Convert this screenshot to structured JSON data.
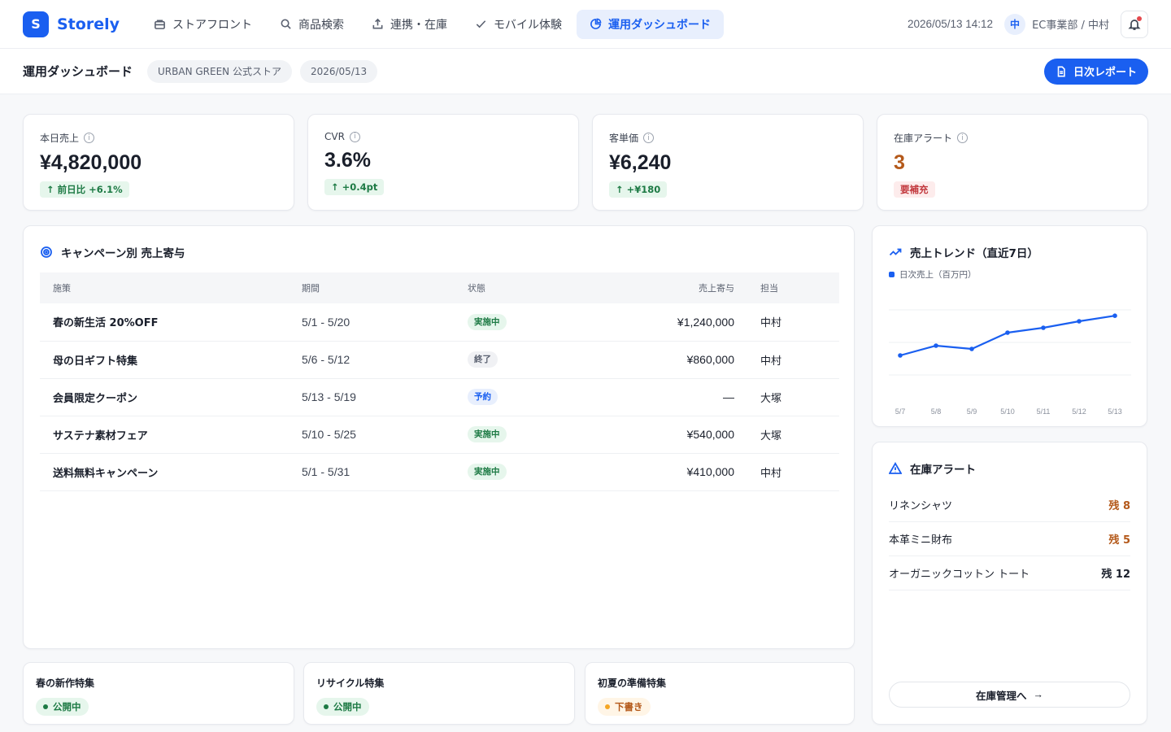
{
  "app": {
    "logo_letter": "S",
    "name": "Storely"
  },
  "nav": [
    {
      "label": "ストアフロント",
      "icon": "storefront-icon",
      "active": false
    },
    {
      "label": "商品検索",
      "icon": "search-icon",
      "active": false
    },
    {
      "label": "連携・在庫",
      "icon": "upload-icon",
      "active": false
    },
    {
      "label": "モバイル体験",
      "icon": "check-icon",
      "active": false
    },
    {
      "label": "運用ダッシュボード",
      "icon": "pie-chart-icon",
      "active": true
    }
  ],
  "header": {
    "datetime": "2026/05/13 14:12",
    "user_initial": "中",
    "user_label": "EC事業部 / 中村"
  },
  "subheader": {
    "title": "運用ダッシュボード",
    "store": "URBAN GREEN 公式ストア",
    "date": "2026/05/13",
    "report_button": "日次レポート"
  },
  "kpis": [
    {
      "label": "本日売上",
      "value": "¥4,820,000",
      "badge": "前日比 +6.1%",
      "badge_type": "up",
      "value_color": "#1a1f2b"
    },
    {
      "label": "CVR",
      "value": "3.6%",
      "badge": "+0.4pt",
      "badge_type": "up",
      "value_color": "#1a1f2b"
    },
    {
      "label": "客単価",
      "value": "¥6,240",
      "badge": "+¥180",
      "badge_type": "up",
      "value_color": "#1a1f2b"
    },
    {
      "label": "在庫アラート",
      "value": "3",
      "badge": "要補充",
      "badge_type": "warn",
      "value_color": "#b4591a"
    }
  ],
  "campaigns": {
    "title": "キャンペーン別 売上寄与",
    "columns": [
      "施策",
      "期間",
      "状態",
      "売上寄与",
      "担当"
    ],
    "rows": [
      {
        "name": "春の新生活 20%OFF",
        "period": "5/1 - 5/20",
        "status": "実施中",
        "status_type": "run",
        "amount": "¥1,240,000",
        "owner": "中村"
      },
      {
        "name": "母の日ギフト特集",
        "period": "5/6 - 5/12",
        "status": "終了",
        "status_type": "end",
        "amount": "¥860,000",
        "owner": "中村"
      },
      {
        "name": "会員限定クーポン",
        "period": "5/13 - 5/19",
        "status": "予約",
        "status_type": "plan",
        "amount": "—",
        "owner": "大塚"
      },
      {
        "name": "サステナ素材フェア",
        "period": "5/10 - 5/25",
        "status": "実施中",
        "status_type": "run",
        "amount": "¥540,000",
        "owner": "大塚"
      },
      {
        "name": "送料無料キャンペーン",
        "period": "5/1 - 5/31",
        "status": "実施中",
        "status_type": "run",
        "amount": "¥410,000",
        "owner": "中村"
      }
    ]
  },
  "trend": {
    "title": "売上トレンド（直近7日）",
    "legend": "日次売上（百万円）"
  },
  "chart_data": {
    "type": "line",
    "x": [
      "5/7",
      "5/8",
      "5/9",
      "5/10",
      "5/11",
      "5/12",
      "5/13"
    ],
    "series": [
      {
        "name": "日次売上（百万円）",
        "values": [
          3.6,
          3.9,
          3.8,
          4.3,
          4.45,
          4.65,
          4.82
        ]
      }
    ],
    "ylim": [
      2.5,
      5.5
    ],
    "grid": true,
    "color": "#1a5ff0"
  },
  "inventory": {
    "title": "在庫アラート",
    "items": [
      {
        "name": "リネンシャツ",
        "qty": "残 8",
        "level": "low"
      },
      {
        "name": "本革ミニ財布",
        "qty": "残 5",
        "level": "low"
      },
      {
        "name": "オーガニックコットン トート",
        "qty": "残 12",
        "level": "normal"
      }
    ],
    "button": "在庫管理へ"
  },
  "features": [
    {
      "title": "春の新作特集",
      "status": "公開中",
      "status_type": "live"
    },
    {
      "title": "リサイクル特集",
      "status": "公開中",
      "status_type": "live"
    },
    {
      "title": "初夏の準備特集",
      "status": "下書き",
      "status_type": "draft"
    }
  ],
  "colors": {
    "accent": "#1a5ff0",
    "success": "#1d7a44",
    "warning": "#b4591a",
    "danger": "#c2383d"
  }
}
